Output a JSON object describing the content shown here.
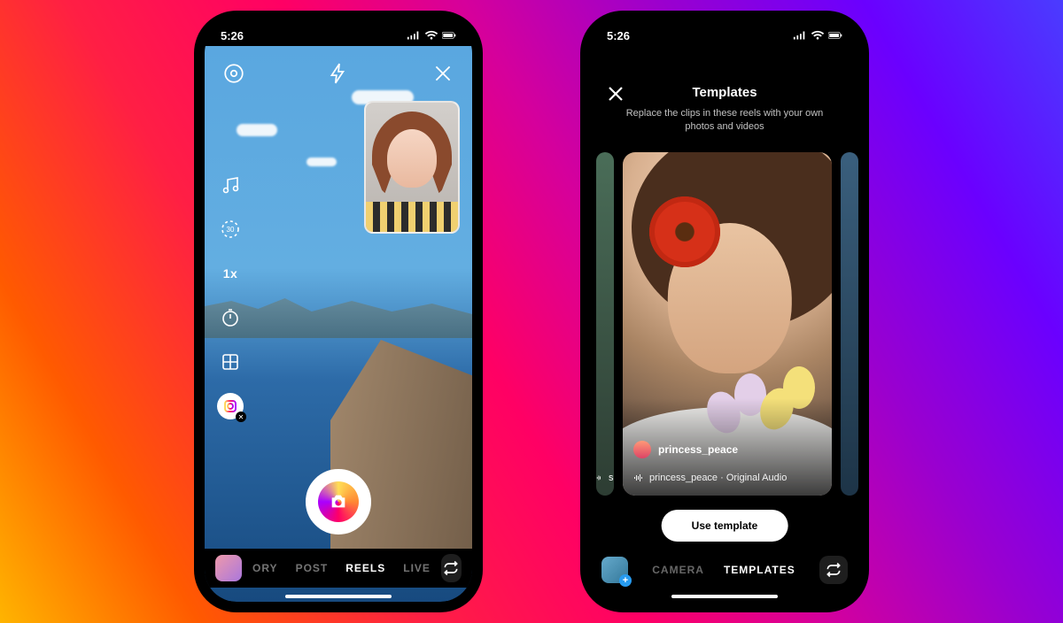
{
  "status": {
    "time": "5:26"
  },
  "phone1": {
    "tools": {
      "settings": "settings",
      "flash": "flash",
      "close": "close",
      "audio": "audio",
      "duration_label": "30",
      "speed_label": "1x",
      "timer": "timer",
      "layout": "layout",
      "effects": "effects"
    },
    "pip_alt": "Front camera preview of a person smiling",
    "modes": {
      "story": "ORY",
      "post": "POST",
      "reels": "REELS",
      "live": "LIVE"
    }
  },
  "phone2": {
    "title": "Templates",
    "subtitle": "Replace the clips in these reels with your own photos and videos",
    "card": {
      "username": "princess_peace",
      "audio_label": "princess_peace · Original Audio"
    },
    "right_peek_audio_prefix": "s",
    "use_button": "Use template",
    "modes": {
      "camera": "CAMERA",
      "templates": "TEMPLATES"
    }
  }
}
